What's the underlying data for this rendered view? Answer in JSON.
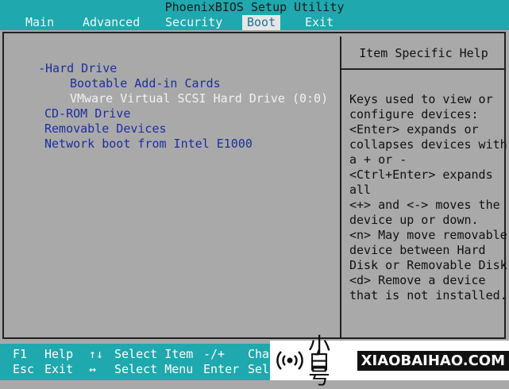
{
  "title": "PhoenixBIOS Setup Utility",
  "menu": [
    {
      "label": "Main",
      "active": false
    },
    {
      "label": "Advanced",
      "active": false
    },
    {
      "label": "Security",
      "active": false
    },
    {
      "label": "Boot",
      "active": true
    },
    {
      "label": "Exit",
      "active": false
    }
  ],
  "boot_list": [
    {
      "label": "-Hard Drive",
      "selected": false
    },
    {
      "label": "Bootable Add-in Cards",
      "selected": false
    },
    {
      "label": "VMware Virtual SCSI Hard Drive (0:0)",
      "selected": true
    },
    {
      "label": "CD-ROM Drive",
      "selected": false
    },
    {
      "label": "Removable Devices",
      "selected": false
    },
    {
      "label": "Network boot from Intel E1000",
      "selected": false
    }
  ],
  "help": {
    "title": "Item Specific Help",
    "lines": [
      "Keys used to view or",
      "configure devices:",
      "<Enter> expands or",
      "collapses devices with",
      "a + or -",
      "<Ctrl+Enter> expands",
      "all",
      "<+> and <-> moves the",
      "device up or down.",
      "<n> May move removable",
      "device between Hard",
      "Disk or Removable Disk",
      "<d> Remove a device",
      "that is not installed."
    ]
  },
  "footer": {
    "row1": {
      "k1": "F1",
      "d1": "Help",
      "k2": "↑↓",
      "d2": "Select Item",
      "k3": "-/+",
      "d3": "Char"
    },
    "row2": {
      "k1": "Esc",
      "d1": "Exit",
      "k2": "↔",
      "d2": "Select Menu",
      "k3": "Enter",
      "d3": "Sele"
    }
  },
  "watermark": {
    "cn": "小白号",
    "en": "XIAOBAIHAO.COM",
    "icon": "radio-wave-icon"
  }
}
